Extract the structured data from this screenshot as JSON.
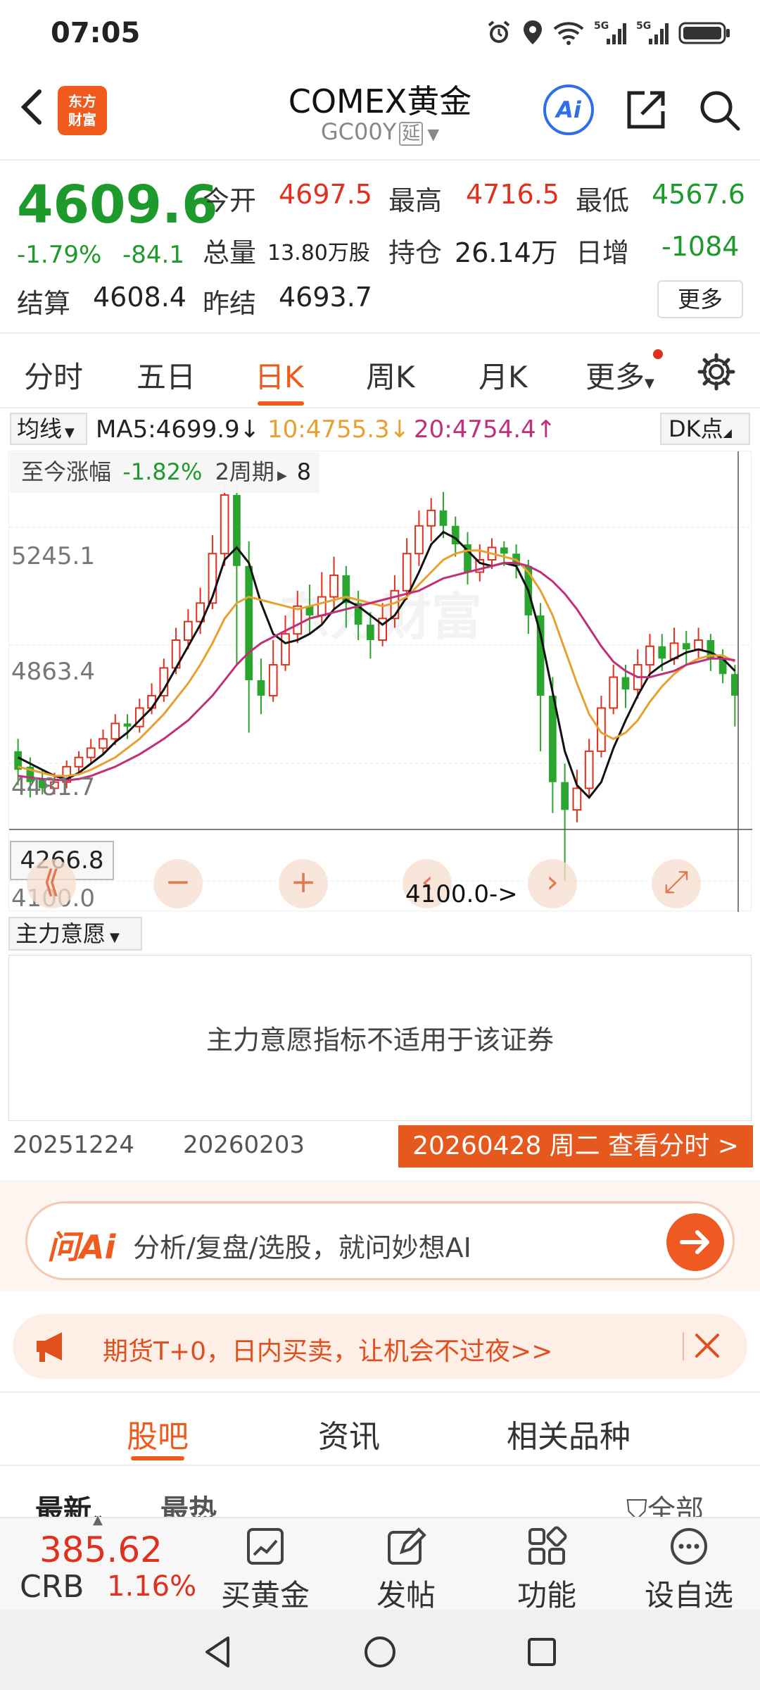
{
  "status_bar": {
    "time": "07:05",
    "icons": [
      "alarm-icon",
      "location-icon",
      "wifi-icon",
      "5g-signal-icon",
      "5g-signal-icon",
      "battery-icon"
    ],
    "network_1": "5G",
    "network_2": "5G"
  },
  "header": {
    "title": "COMEX黄金",
    "code": "GC00Y",
    "delay_badge": "延",
    "logo_text_1": "东方",
    "logo_text_2": "财富",
    "ai_label": "Ai"
  },
  "quote": {
    "price": "4609.6",
    "change_pct": "-1.79%",
    "change_abs": "-84.1",
    "open_label": "今开",
    "open": "4697.5",
    "high_label": "最高",
    "high": "4716.5",
    "low_label": "最低",
    "low": "4567.6",
    "volume_label": "总量",
    "volume": "13.80万股",
    "position_label": "持仓",
    "position": "26.14万",
    "daily_inc_label": "日增",
    "daily_inc": "-1084",
    "settle_label": "结算",
    "settle": "4608.4",
    "prev_settle_label": "昨结",
    "prev_settle": "4693.7",
    "more_label": "更多"
  },
  "kline_tabs": [
    {
      "label": "分时"
    },
    {
      "label": "五日"
    },
    {
      "label": "日K"
    },
    {
      "label": "周K"
    },
    {
      "label": "月K"
    },
    {
      "label": "更多"
    }
  ],
  "active_tab": "日K",
  "indicator": {
    "select_label": "均线",
    "ma5": "MA5:4699.9↓",
    "ma10": "10:4755.3↓",
    "ma20": "20:4754.4↑",
    "dk_label": "DK点"
  },
  "chart": {
    "change_label": "至今涨幅",
    "change_value": "-1.82%",
    "period": "2周期",
    "hidden_suffix": "8",
    "y_labels": [
      "5245.1",
      "4863.4",
      "4481.7",
      "4100.0"
    ],
    "low_box": "4266.8",
    "min_marker": "4100.0->",
    "controls": [
      "⟪",
      "−",
      "+",
      "‹",
      "›",
      "⤢"
    ]
  },
  "chart_data": {
    "type": "candlestick",
    "ylim": [
      4100.0,
      5400.0
    ],
    "y_ticks": [
      5245.1,
      4863.4,
      4481.7,
      4100.0
    ],
    "x_labels": [
      "20251224",
      "20260203"
    ],
    "selected_date": "20260428 周二",
    "candles": [
      [
        4520,
        4460,
        4560,
        4410
      ],
      [
        4470,
        4420,
        4500,
        4370
      ],
      [
        4430,
        4400,
        4460,
        4380
      ],
      [
        4400,
        4420,
        4450,
        4380
      ],
      [
        4420,
        4470,
        4490,
        4400
      ],
      [
        4470,
        4500,
        4520,
        4450
      ],
      [
        4500,
        4530,
        4560,
        4480
      ],
      [
        4530,
        4560,
        4590,
        4510
      ],
      [
        4560,
        4610,
        4640,
        4540
      ],
      [
        4610,
        4600,
        4640,
        4560
      ],
      [
        4600,
        4660,
        4690,
        4580
      ],
      [
        4660,
        4700,
        4740,
        4640
      ],
      [
        4700,
        4790,
        4820,
        4680
      ],
      [
        4790,
        4880,
        4920,
        4770
      ],
      [
        4880,
        4940,
        4980,
        4850
      ],
      [
        4940,
        5000,
        5050,
        4900
      ],
      [
        5000,
        5160,
        5220,
        4980
      ],
      [
        5160,
        5350,
        5380,
        5120
      ],
      [
        5350,
        5120,
        5380,
        4800
      ],
      [
        5120,
        4750,
        5200,
        4580
      ],
      [
        4750,
        4700,
        4820,
        4640
      ],
      [
        4700,
        4800,
        4880,
        4680
      ],
      [
        4800,
        4900,
        4960,
        4780
      ],
      [
        4900,
        4990,
        5040,
        4870
      ],
      [
        4990,
        4960,
        5060,
        4900
      ],
      [
        4960,
        5020,
        5100,
        4930
      ],
      [
        5020,
        5090,
        5150,
        4980
      ],
      [
        5090,
        5000,
        5120,
        4920
      ],
      [
        5000,
        4930,
        5040,
        4880
      ],
      [
        4930,
        4880,
        4970,
        4820
      ],
      [
        4880,
        4950,
        5000,
        4860
      ],
      [
        4950,
        5040,
        5090,
        4920
      ],
      [
        5040,
        5160,
        5210,
        5010
      ],
      [
        5160,
        5250,
        5300,
        5120
      ],
      [
        5250,
        5300,
        5340,
        5200
      ],
      [
        5300,
        5250,
        5360,
        5210
      ],
      [
        5250,
        5190,
        5280,
        5150
      ],
      [
        5190,
        5100,
        5230,
        5060
      ],
      [
        5100,
        5140,
        5190,
        5070
      ],
      [
        5140,
        5180,
        5210,
        5110
      ],
      [
        5180,
        5160,
        5200,
        5120
      ],
      [
        5160,
        5120,
        5190,
        5080
      ],
      [
        5120,
        4960,
        5140,
        4900
      ],
      [
        4960,
        4700,
        5000,
        4520
      ],
      [
        4700,
        4420,
        4760,
        4320
      ],
      [
        4420,
        4330,
        4480,
        4100
      ],
      [
        4330,
        4400,
        4460,
        4290
      ],
      [
        4400,
        4520,
        4560,
        4370
      ],
      [
        4520,
        4660,
        4700,
        4500
      ],
      [
        4660,
        4760,
        4800,
        4640
      ],
      [
        4760,
        4720,
        4800,
        4660
      ],
      [
        4720,
        4800,
        4850,
        4690
      ],
      [
        4800,
        4860,
        4900,
        4770
      ],
      [
        4860,
        4820,
        4900,
        4780
      ],
      [
        4820,
        4870,
        4920,
        4800
      ],
      [
        4870,
        4850,
        4910,
        4800
      ],
      [
        4850,
        4880,
        4920,
        4820
      ],
      [
        4880,
        4820,
        4900,
        4780
      ],
      [
        4820,
        4770,
        4850,
        4740
      ],
      [
        4770,
        4700,
        4800,
        4600
      ]
    ],
    "ma_series": [
      {
        "name": "MA5",
        "color": "#111111",
        "values": [
          4500,
          4480,
          4460,
          4440,
          4430,
          4450,
          4480,
          4510,
          4550,
          4580,
          4620,
          4660,
          4720,
          4790,
          4860,
          4930,
          5020,
          5140,
          5180,
          5130,
          5000,
          4900,
          4870,
          4880,
          4900,
          4930,
          4980,
          5010,
          4990,
          4960,
          4930,
          4960,
          5020,
          5100,
          5190,
          5230,
          5210,
          5170,
          5130,
          5120,
          5130,
          5120,
          5040,
          4900,
          4710,
          4520,
          4410,
          4370,
          4420,
          4530,
          4620,
          4700,
          4770,
          4800,
          4820,
          4840,
          4850,
          4840,
          4820,
          4780
        ]
      },
      {
        "name": "MA10",
        "color": "#e8a030",
        "values": [
          4470,
          4460,
          4450,
          4440,
          4440,
          4445,
          4460,
          4480,
          4500,
          4530,
          4560,
          4600,
          4640,
          4690,
          4740,
          4800,
          4870,
          4950,
          5000,
          5020,
          5010,
          5000,
          4990,
          4980,
          4990,
          5000,
          5010,
          5020,
          5010,
          5000,
          4990,
          5000,
          5020,
          5060,
          5100,
          5140,
          5160,
          5170,
          5170,
          5160,
          5150,
          5140,
          5100,
          5040,
          4960,
          4850,
          4740,
          4640,
          4580,
          4560,
          4580,
          4620,
          4680,
          4730,
          4770,
          4800,
          4820,
          4830,
          4830,
          4810
        ]
      },
      {
        "name": "MA20",
        "color": "#c0307a",
        "values": [
          4440,
          4435,
          4430,
          4428,
          4426,
          4430,
          4440,
          4455,
          4470,
          4490,
          4510,
          4535,
          4560,
          4590,
          4620,
          4660,
          4700,
          4750,
          4800,
          4840,
          4870,
          4890,
          4910,
          4930,
          4950,
          4960,
          4970,
          4980,
          4990,
          5000,
          5010,
          5020,
          5030,
          5040,
          5060,
          5080,
          5090,
          5100,
          5110,
          5120,
          5130,
          5130,
          5120,
          5100,
          5070,
          5030,
          4980,
          4920,
          4860,
          4810,
          4780,
          4760,
          4760,
          4770,
          4780,
          4800,
          4810,
          4820,
          4820,
          4815
        ]
      }
    ]
  },
  "indicator2": {
    "select_label": "主力意愿",
    "message": "主力意愿指标不适用于该证券"
  },
  "dates": {
    "d1": "20251224",
    "d2": "20260203",
    "tag": "20260428 周二 查看分时 >"
  },
  "ai_bar": {
    "logo": "问Ai",
    "placeholder": "分析/复盘/选股，就问妙想AI"
  },
  "promo": {
    "text": "期货T+0，日内买卖，让机会不过夜>>"
  },
  "content_tabs": [
    {
      "label": "股吧"
    },
    {
      "label": "资讯"
    },
    {
      "label": "相关品种"
    }
  ],
  "sub_tabs": {
    "latest": "最新",
    "hot": "最热",
    "all": "全部"
  },
  "bottom_bar": {
    "crb_value": "385.62",
    "crb_name": "CRB",
    "crb_pct": "1.16%",
    "actions": [
      {
        "label": "买黄金",
        "icon": "chart-box-icon"
      },
      {
        "label": "发帖",
        "icon": "edit-icon"
      },
      {
        "label": "功能",
        "icon": "grid-icon"
      },
      {
        "label": "设自选",
        "icon": "more-circle-icon"
      }
    ]
  },
  "colors": {
    "accent": "#f05a1c",
    "up": "#e0301e",
    "down": "#1e9a2c"
  }
}
